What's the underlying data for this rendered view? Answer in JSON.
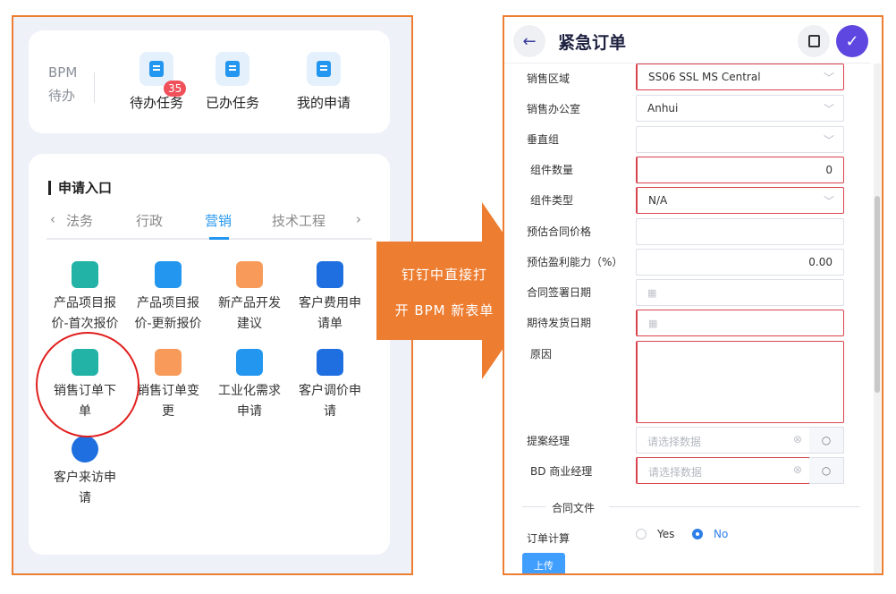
{
  "left": {
    "bpm": {
      "label_line1": "BPM",
      "label_line2": "待办",
      "items": [
        {
          "label": "待办任务",
          "badge": "35",
          "icon": "task-list-icon"
        },
        {
          "label": "已办任务",
          "icon": "clipboard-check-icon"
        },
        {
          "label": "我的申请",
          "icon": "edit-document-icon"
        }
      ]
    },
    "entry": {
      "title": "申请入口",
      "prev_arrow": "‹",
      "next_arrow": "›",
      "tabs": [
        "法务",
        "行政",
        "营销",
        "技术工程"
      ],
      "active_tab": "营销",
      "items": [
        {
          "line1": "产品项目报",
          "line2": "价-首次报价",
          "icon": "folder-icon",
          "color": "#22b3a6"
        },
        {
          "line1": "产品项目报",
          "line2": "价-更新报价",
          "icon": "lock-icon",
          "color": "#2396ef"
        },
        {
          "line1": "新产品开发",
          "line2": "建议",
          "icon": "box-icon",
          "color": "#f79a5a"
        },
        {
          "line1": "客户费用申",
          "line2": "请单",
          "icon": "person-card-icon",
          "color": "#1f6fe0"
        },
        {
          "line1": "销售订单下",
          "line2": "单",
          "icon": "download-form-icon",
          "color": "#22b3a6"
        },
        {
          "line1": "销售订单变",
          "line2": "更",
          "icon": "edit-form-icon",
          "color": "#f79a5a"
        },
        {
          "line1": "工业化需求",
          "line2": "申请",
          "icon": "lock-icon",
          "color": "#2396ef"
        },
        {
          "line1": "客户调价申",
          "line2": "请",
          "icon": "price-tag-icon",
          "color": "#1f6fe0"
        },
        {
          "line1": "客户来访申",
          "line2": "请",
          "icon": "visitor-icon",
          "color": "#1f6fe0"
        }
      ]
    }
  },
  "arrow": {
    "line1": "钉钉中直接打",
    "line2": "开 BPM 新表单",
    "color": "#ed7d31"
  },
  "right": {
    "title": "紧急订单",
    "fields": [
      {
        "label": "销售区域",
        "value": "SS06 SSL MS Central",
        "type": "select"
      },
      {
        "label": "销售办公室",
        "value": "Anhui",
        "type": "select"
      },
      {
        "label": "垂直组",
        "value": "",
        "type": "select"
      },
      {
        "label": "组件数量",
        "value": "0",
        "type": "number"
      },
      {
        "label": "组件类型",
        "value": "N/A",
        "type": "select"
      },
      {
        "label": "预估合同价格",
        "value": "",
        "type": "text"
      },
      {
        "label": "预估盈利能力（%）",
        "value": "0.00",
        "type": "number"
      },
      {
        "label": "合同签署日期",
        "value": "",
        "type": "date"
      },
      {
        "label": "期待发货日期",
        "value": "",
        "type": "date"
      },
      {
        "label": "原因",
        "value": "",
        "type": "textarea"
      }
    ],
    "pickers": [
      {
        "label": "提案经理",
        "placeholder": "请选择数据"
      },
      {
        "label": "BD 商业经理",
        "placeholder": "请选择数据"
      }
    ],
    "section": "合同文件",
    "order_calc": {
      "label": "订单计算",
      "options": [
        "Yes",
        "No"
      ],
      "selected": "No"
    },
    "upload_label": "上传"
  }
}
